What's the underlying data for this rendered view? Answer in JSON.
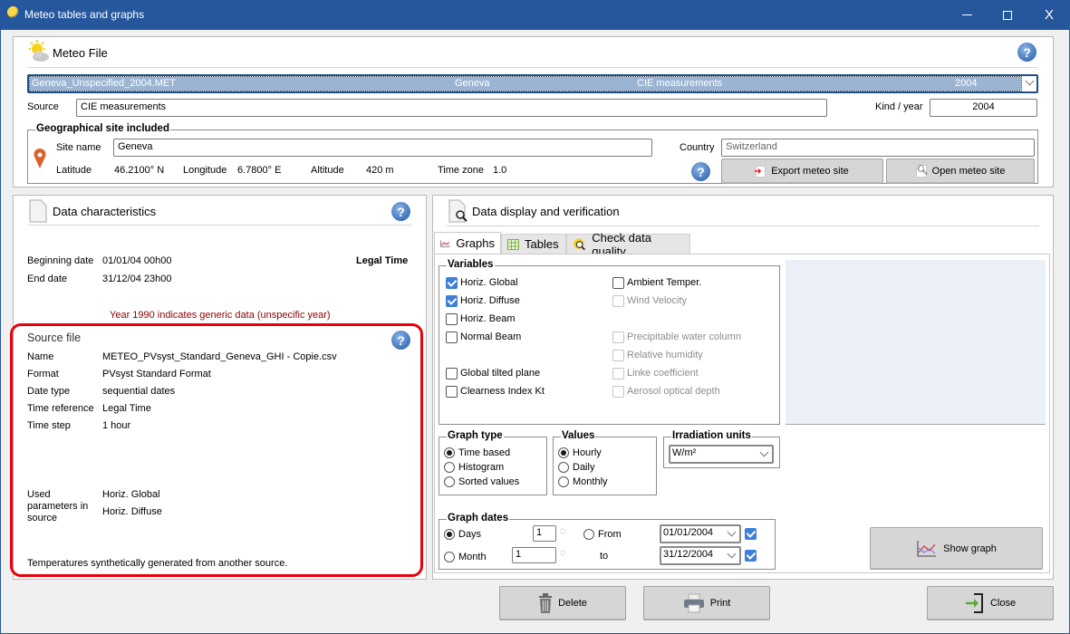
{
  "window": {
    "title": "Meteo tables and graphs",
    "minimize": "—",
    "maximize": "☐",
    "close": "X"
  },
  "meteo_file": {
    "header": "Meteo File",
    "selected": {
      "file": "Geneva_Unspecified_2004.MET",
      "site": "Geneva",
      "source": "CIE measurements",
      "year": "2004"
    },
    "source_label": "Source",
    "source_value": "CIE measurements",
    "kind_year_label": "Kind / year",
    "kind_year_value": "2004"
  },
  "geo_site": {
    "group_title": "Geographical site included",
    "site_name_label": "Site name",
    "site_name_value": "Geneva",
    "country_label": "Country",
    "country_value": "Switzerland",
    "latitude_label": "Latitude",
    "latitude_value": "46.2100° N",
    "longitude_label": "Longitude",
    "longitude_value": "6.7800° E",
    "altitude_label": "Altitude",
    "altitude_value": "420 m",
    "timezone_label": "Time zone",
    "timezone_value": "1.0",
    "export_button": "Export meteo site",
    "open_button": "Open meteo site"
  },
  "data_characteristics": {
    "header": "Data characteristics",
    "beginning_label": "Beginning date",
    "beginning_value": "01/01/04 00h00",
    "end_label": "End date",
    "end_value": "31/12/04 23h00",
    "time_mode": "Legal Time",
    "note": "Year 1990 indicates generic data (unspecific year)"
  },
  "source_file": {
    "header": "Source file",
    "rows": [
      {
        "label": "Name",
        "value": "METEO_PVsyst_Standard_Geneva_GHI - Copie.csv"
      },
      {
        "label": "Format",
        "value": "PVsyst Standard Format"
      },
      {
        "label": "Date type",
        "value": "sequential dates"
      },
      {
        "label": "Time reference",
        "value": "Legal Time"
      },
      {
        "label": "Time step",
        "value": "1 hour"
      }
    ],
    "used_params_label": "Used parameters in source",
    "used_params": [
      "Horiz. Global",
      "Horiz. Diffuse"
    ],
    "footer": "Temperatures synthetically generated from another source."
  },
  "display": {
    "header": "Data display and verification",
    "tabs": [
      {
        "label": "Graphs",
        "active": true
      },
      {
        "label": "Tables",
        "active": false
      },
      {
        "label": "Check data quality",
        "active": false
      }
    ],
    "variables": {
      "title": "Variables",
      "left": [
        {
          "label": "Horiz. Global",
          "checked": true,
          "enabled": true
        },
        {
          "label": "Horiz. Diffuse",
          "checked": true,
          "enabled": true
        },
        {
          "label": "Horiz. Beam",
          "checked": false,
          "enabled": true
        },
        {
          "label": "Normal Beam",
          "checked": false,
          "enabled": true
        },
        {
          "label": "Global tilted plane",
          "checked": false,
          "enabled": true
        },
        {
          "label": "Clearness Index Kt",
          "checked": false,
          "enabled": true
        }
      ],
      "right": [
        {
          "label": "Ambient Temper.",
          "checked": false,
          "enabled": true
        },
        {
          "label": "Wind Velocity",
          "checked": false,
          "enabled": false
        },
        {
          "label": "Precipitable water column",
          "checked": false,
          "enabled": false
        },
        {
          "label": "Relative humidity",
          "checked": false,
          "enabled": false
        },
        {
          "label": "Linke coefficient",
          "checked": false,
          "enabled": false
        },
        {
          "label": "Aerosol optical depth",
          "checked": false,
          "enabled": false
        }
      ]
    },
    "graph_type": {
      "title": "Graph type",
      "options": [
        "Time based",
        "Histogram",
        "Sorted values"
      ],
      "selected": "Time based"
    },
    "values": {
      "title": "Values",
      "options": [
        "Hourly",
        "Daily",
        "Monthly"
      ],
      "selected": "Hourly"
    },
    "irradiation_units": {
      "title": "Irradiation units",
      "selected": "W/m²"
    },
    "graph_dates": {
      "title": "Graph dates",
      "days_label": "Days",
      "days_value": "1",
      "month_label": "Month",
      "month_value": "1",
      "mode_selected": "Days",
      "from_label": "From",
      "from_value": "01/01/2004",
      "to_label": "to",
      "to_value": "31/12/2004",
      "from_checked": true,
      "to_checked": true
    },
    "show_graph_button": "Show graph"
  },
  "footer": {
    "delete_button": "Delete",
    "print_button": "Print",
    "close_button": "Close"
  },
  "colors": {
    "titlebar": "#26579d",
    "selection": "#9bb4d2",
    "highlight_border": "#e8000b",
    "note_text": "#8b0000",
    "graph_area": "#ebf0f8"
  }
}
